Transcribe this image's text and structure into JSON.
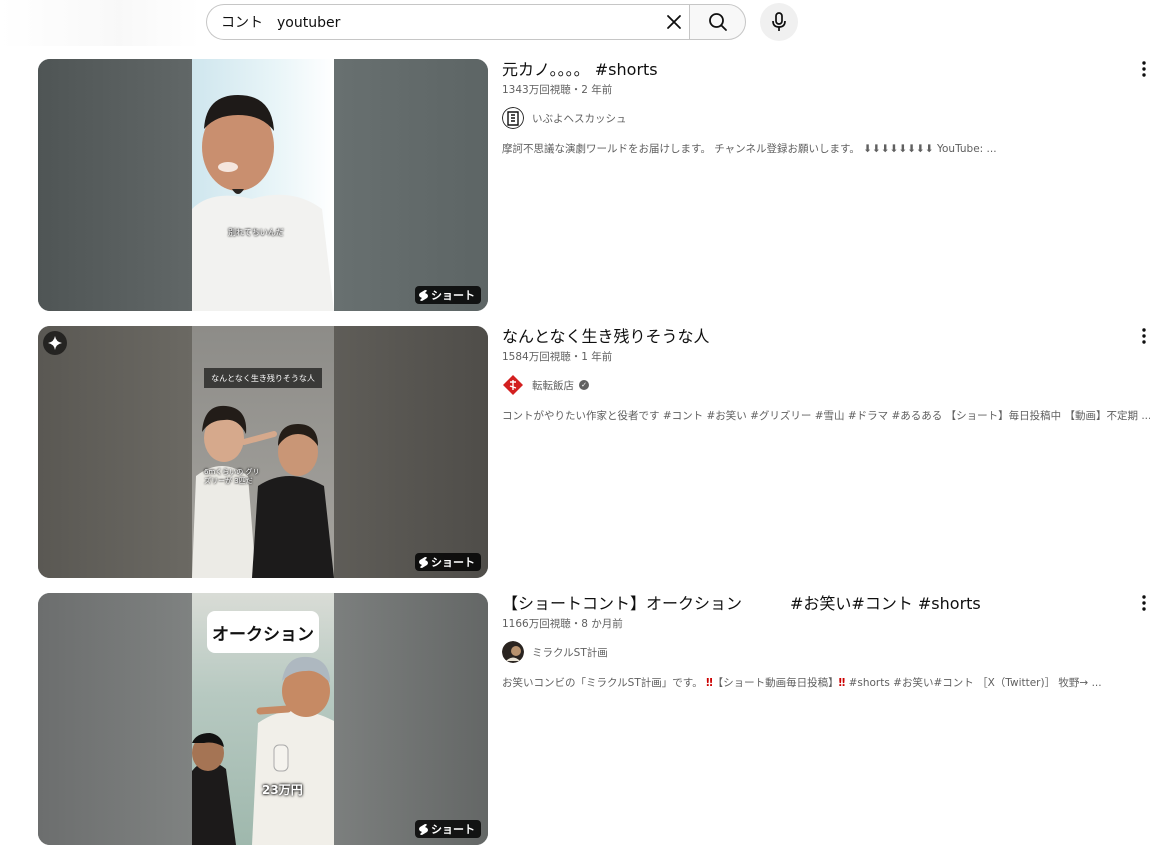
{
  "search": {
    "query": "コント　youtuber",
    "clear_icon": "close-icon",
    "search_icon": "search-icon",
    "mic_icon": "microphone-icon"
  },
  "results": [
    {
      "title": "元カノ。。。。 #shorts",
      "meta": "1343万回視聴・2 年前",
      "channel": "いぶよヘスカッシュ",
      "verified": false,
      "description": "摩訶不思議な演劇ワールドをお届けします。 チャンネル登録お願いします。 ⬇⬇⬇⬇⬇⬇⬇⬇ YouTube: ...",
      "badge": "ショート",
      "caption": "別れてちいんだ"
    },
    {
      "title": "なんとなく生き残りそうな人",
      "meta": "1584万回視聴・1 年前",
      "channel": "転転飯店",
      "verified": true,
      "description": "コントがやりたい作家と役者です #コント #お笑い #グリズリー #雪山 #ドラマ #あるある 【ショート】毎日投稿中 【動画】不定期 ...",
      "badge": "ショート",
      "caption": "なんとなく生き残りそうな人",
      "caption2": "6mくらいの グリズリーが 3匹だ"
    },
    {
      "title": "【ショートコント】オークション　　　#お笑い#コント #shorts",
      "meta": "1166万回視聴・8 か月前",
      "channel": "ミラクルST計画",
      "verified": false,
      "description_parts": [
        "お笑いコンビの「ミラクルST計画」です。",
        "‼",
        "【ショート動画毎日投稿】",
        "‼",
        " #shorts #お笑い#コント ［X（Twitter)］ 牧野→ ..."
      ],
      "badge": "ショート",
      "caption": "オークション",
      "caption2": "23万円"
    }
  ],
  "colors": {
    "accent_red": "#cc0000",
    "text_primary": "#0f0f0f",
    "text_secondary": "#606060"
  }
}
